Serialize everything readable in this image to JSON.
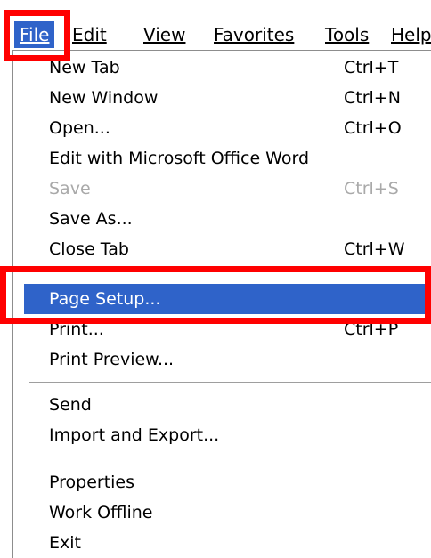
{
  "menubar": {
    "items": [
      {
        "label": "File",
        "active": true
      },
      {
        "label": "Edit",
        "active": false
      },
      {
        "label": "View",
        "active": false
      },
      {
        "label": "Favorites",
        "active": false
      },
      {
        "label": "Tools",
        "active": false
      },
      {
        "label": "Help",
        "active": false
      }
    ]
  },
  "file_menu": {
    "items": [
      {
        "label": "New Tab",
        "shortcut": "Ctrl+T",
        "disabled": false,
        "selected": false
      },
      {
        "label": "New Window",
        "shortcut": "Ctrl+N",
        "disabled": false,
        "selected": false
      },
      {
        "label": "Open...",
        "shortcut": "Ctrl+O",
        "disabled": false,
        "selected": false
      },
      {
        "label": "Edit with Microsoft Office Word",
        "shortcut": "",
        "disabled": false,
        "selected": false
      },
      {
        "label": "Save",
        "shortcut": "Ctrl+S",
        "disabled": true,
        "selected": false
      },
      {
        "label": "Save As...",
        "shortcut": "",
        "disabled": false,
        "selected": false
      },
      {
        "label": "Close Tab",
        "shortcut": "Ctrl+W",
        "disabled": false,
        "selected": false
      },
      {
        "label": "Page Setup...",
        "shortcut": "",
        "disabled": false,
        "selected": true
      },
      {
        "label": "Print...",
        "shortcut": "Ctrl+P",
        "disabled": false,
        "selected": false
      },
      {
        "label": "Print Preview...",
        "shortcut": "",
        "disabled": false,
        "selected": false
      },
      {
        "label": "Send",
        "shortcut": "",
        "disabled": false,
        "selected": false,
        "has_submenu": true
      },
      {
        "label": "Import and Export...",
        "shortcut": "",
        "disabled": false,
        "selected": false
      },
      {
        "label": "Properties",
        "shortcut": "",
        "disabled": false,
        "selected": false
      },
      {
        "label": "Work Offline",
        "shortcut": "",
        "disabled": false,
        "selected": false
      },
      {
        "label": "Exit",
        "shortcut": "",
        "disabled": false,
        "selected": false
      }
    ]
  },
  "colors": {
    "selection": "#2f63c9",
    "highlight": "#ff0000",
    "disabled_text": "#a9a9a9"
  },
  "icons": {
    "submenu": "submenu-arrow-icon"
  }
}
